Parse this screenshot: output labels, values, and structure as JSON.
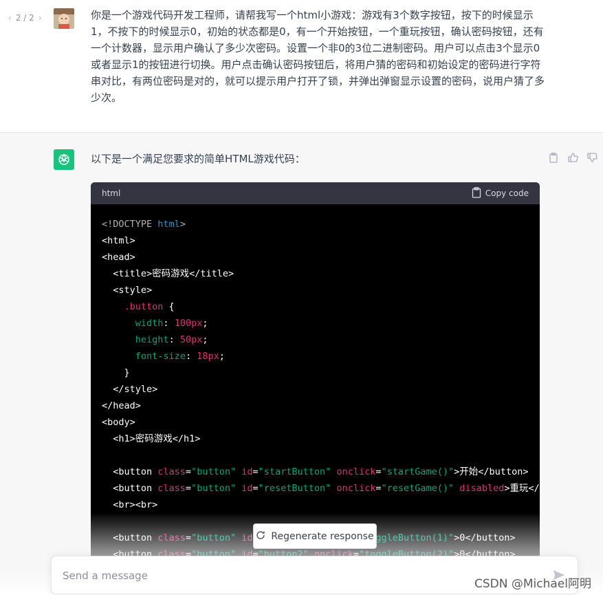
{
  "user_message": {
    "pager": "2 / 2",
    "text": "你是一个游戏代码开发工程师，请帮我写一个html小游戏：游戏有3个数字按钮，按下的时候显示1，不按下的时候显示0，初始的状态都是0，有一个开始按钮，一个重玩按钮，确认密码按钮，还有一个计数器，显示用户确认了多少次密码。设置一个非0的3位二进制密码。用户可以点击3个显示0或者显示1的按钮进行切换。用户点击确认密码按钮后，将用户猜的密码和初始设定的密码进行字符串对比，有两位密码是对的，就可以提示用户打开了锁，并弹出弹窗显示设置的密码，说用户猜了多少次。"
  },
  "assistant": {
    "intro": "以下是一个满足您要求的简单HTML游戏代码："
  },
  "code_block": {
    "language": "html",
    "copy_label": "Copy code"
  },
  "regenerate_label": "Regenerate response",
  "input": {
    "placeholder": "Send a message"
  },
  "watermark": "CSDN @Michael阿明",
  "colors": {
    "accent": "#19c37d",
    "code_bg": "#000000",
    "code_header": "#343541"
  }
}
